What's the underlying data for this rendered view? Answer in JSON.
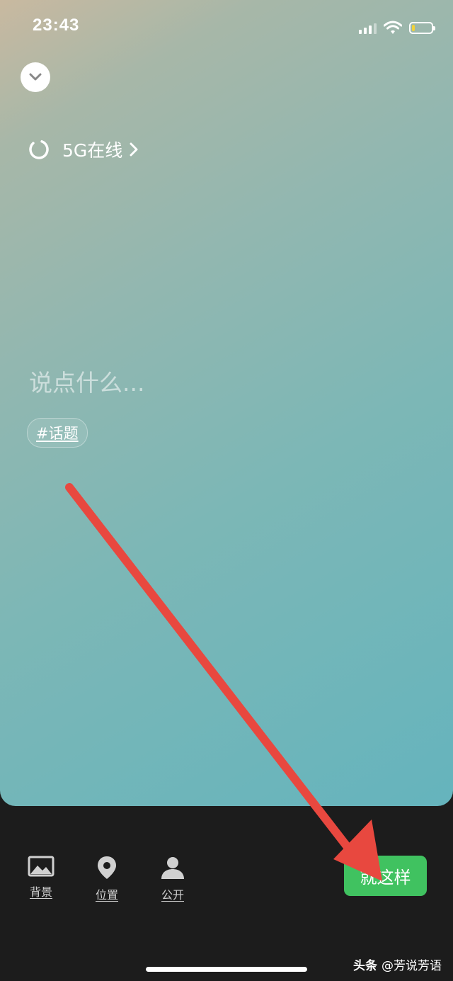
{
  "status_bar": {
    "time": "23:43",
    "battery_level": 0.15,
    "battery_color": "#f1d23a"
  },
  "header": {
    "collapse_icon": "chevron-down-icon",
    "status_label": "5G在线"
  },
  "compose": {
    "placeholder": "说点什么...",
    "topic_label": "#话题"
  },
  "toolbar": {
    "items": [
      {
        "label": "背景",
        "icon": "image-icon"
      },
      {
        "label": "位置",
        "icon": "location-pin-icon"
      },
      {
        "label": "公开",
        "icon": "person-icon"
      }
    ],
    "publish_label": "就这样",
    "publish_color": "#40c260"
  },
  "annotation": {
    "arrow_color": "#e8483f"
  },
  "watermark": {
    "brand": "头条",
    "handle": "@芳说芳语"
  }
}
